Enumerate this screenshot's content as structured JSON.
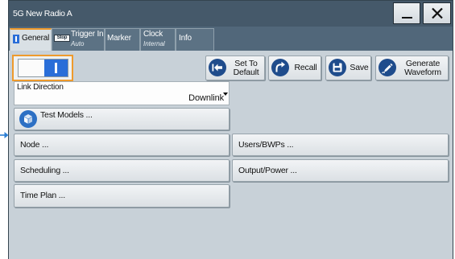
{
  "window": {
    "title": "5G New Radio A",
    "minimize_icon": "minimize-icon",
    "close_icon": "close-icon"
  },
  "tabs": [
    {
      "label": "General",
      "icon": "state-on-icon",
      "active": true
    },
    {
      "label": "Trigger In",
      "sub": "Auto",
      "badge": "Stop",
      "active": false
    },
    {
      "label": "Marker",
      "active": false
    },
    {
      "label": "Clock",
      "sub": "Internal",
      "active": false
    },
    {
      "label": "Info",
      "active": false
    }
  ],
  "state_toggle": {
    "on": true,
    "icon": "state-on-icon"
  },
  "toolbar": {
    "set_default": {
      "label_line1": "Set To",
      "label_line2": "Default",
      "icon": "set-default-icon"
    },
    "recall": {
      "label": "Recall",
      "icon": "recall-icon"
    },
    "save": {
      "label": "Save",
      "icon": "save-icon"
    },
    "generate_waveform": {
      "label_line1": "Generate",
      "label_line2": "Waveform",
      "icon": "generate-waveform-icon"
    }
  },
  "link_direction": {
    "label": "Link Direction",
    "value": "Downlink",
    "icon": "dropdown-arrow-icon"
  },
  "menu": {
    "test_models": {
      "label": "Test Models ...",
      "icon": "test-models-icon"
    },
    "node": {
      "label": "Node ..."
    },
    "users_bwps": {
      "label": "Users/BWPs ..."
    },
    "scheduling": {
      "label": "Scheduling ..."
    },
    "output_power": {
      "label": "Output/Power ..."
    },
    "time_plan": {
      "label": "Time Plan ..."
    }
  },
  "side_marker": {
    "icon": "pointer-arrow-icon"
  },
  "colors": {
    "title_bar": "#45596a",
    "tab_strip": "#51677a",
    "tab_bg": "#5c7284",
    "content_bg": "#c8d1d8",
    "focus_accent": "#ee9a2c",
    "state_on": "#2a6ed8",
    "icon_blue": "#1f4c8c",
    "icon_blue_light": "#2d70c4",
    "pointer_blue": "#2c7fd4"
  }
}
